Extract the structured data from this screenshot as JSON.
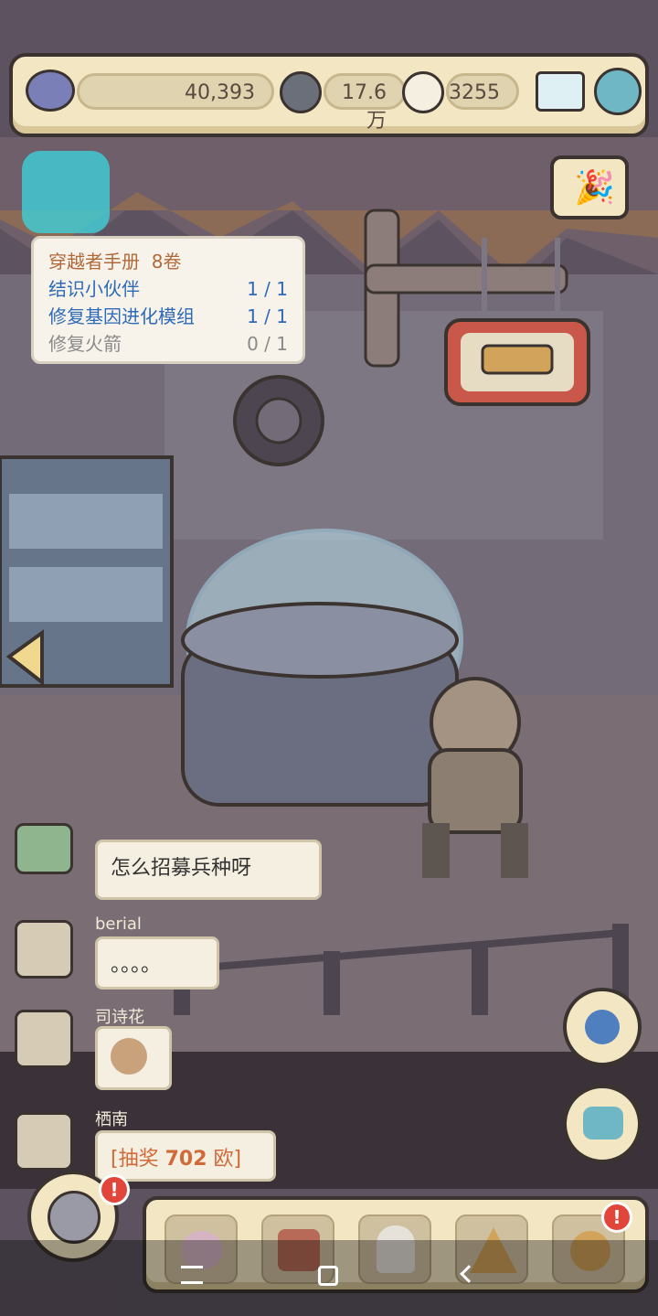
{
  "currency": {
    "views": "40,393",
    "messages": "17.6万",
    "likes": "3255"
  },
  "quest": {
    "title": "穿越者手册",
    "volume": "8卷",
    "items": [
      {
        "label": "结识小伙伴",
        "progress": "1 / 1",
        "done": true
      },
      {
        "label": "修复基因进化模组",
        "progress": "1 / 1",
        "done": true
      },
      {
        "label": "修复火箭",
        "progress": "0 / 1",
        "done": false
      }
    ]
  },
  "chat": [
    {
      "name": "",
      "message": "怎么招募兵种呀"
    },
    {
      "name": "berial",
      "message": "。。。。"
    },
    {
      "name": "司诗花",
      "message": ""
    },
    {
      "name": "栖南",
      "message_prefix": "[抽奖 ",
      "message_value": "702",
      "message_suffix": " 欧]"
    }
  ],
  "badges": {
    "left": "!",
    "right": "!"
  },
  "colors": {
    "panel": "#f3e6c2",
    "outline": "#3b3330",
    "accent": "#e2463a"
  }
}
